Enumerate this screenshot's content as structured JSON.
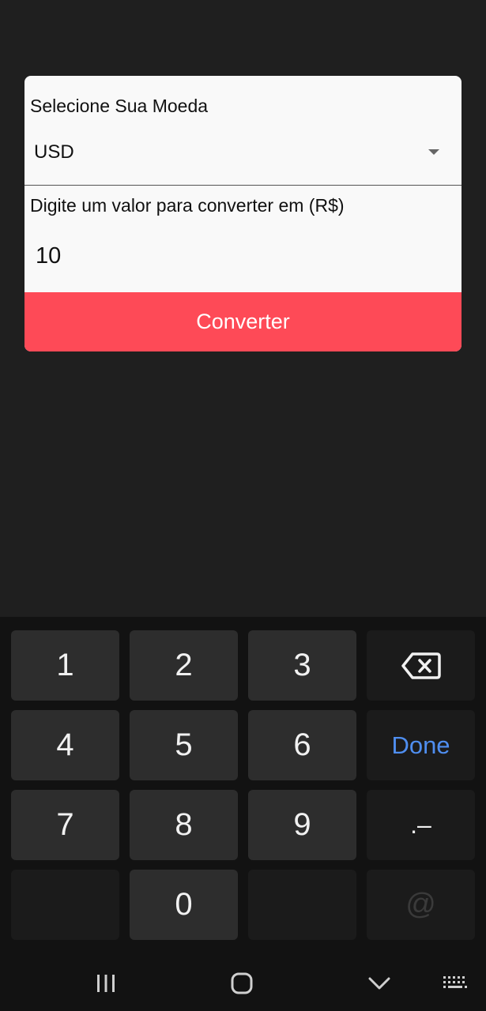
{
  "form": {
    "currency_label": "Selecione Sua Moeda",
    "currency_value": "USD",
    "amount_label": "Digite um valor para converter em (R$)",
    "amount_value": "10",
    "convert_button": "Converter"
  },
  "keyboard": {
    "keys": [
      "1",
      "2",
      "3",
      "4",
      "5",
      "6",
      "7",
      "8",
      "9",
      "0"
    ],
    "done_label": "Done",
    "punct_label": ".–",
    "at_label": "@",
    "backspace_icon": "backspace-icon"
  },
  "navbar": {
    "icons": [
      "recent-apps-icon",
      "home-icon",
      "hide-keyboard-icon",
      "keyboard-switch-icon"
    ]
  },
  "colors": {
    "background": "#1f1f1f",
    "card": "#f9f9f9",
    "accent_button": "#fe4a57",
    "done_text": "#4f8ef0"
  }
}
